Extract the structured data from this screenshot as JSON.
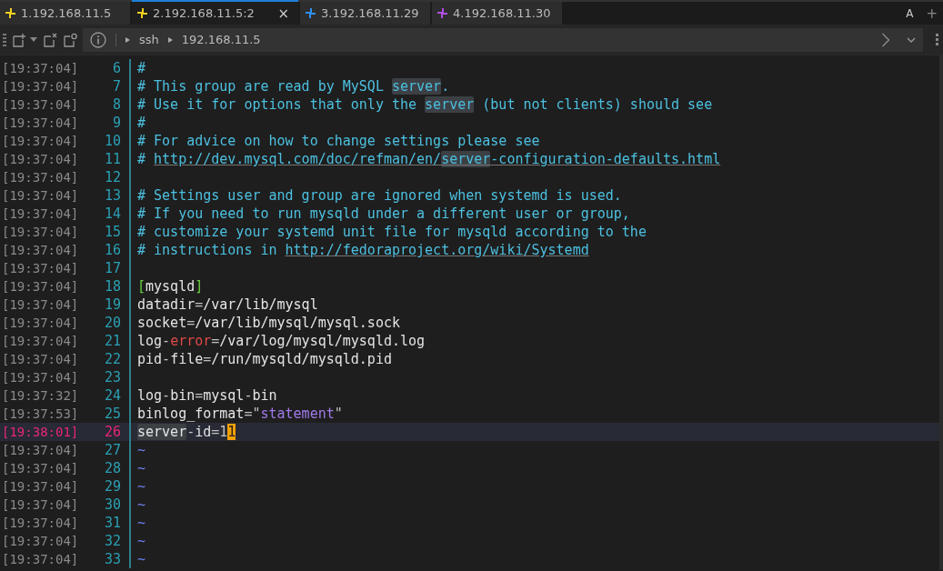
{
  "tabs": [
    {
      "label": "1.192.168.11.5",
      "selected": false,
      "color": "#f0d020"
    },
    {
      "label": "2.192.168.11.5:2",
      "selected": true,
      "close": "×",
      "color": "#f0d020"
    },
    {
      "label": "3.192.168.11.29",
      "selected": false,
      "color": "#2f8ff0"
    },
    {
      "label": "4.192.168.11.30",
      "selected": false,
      "color": "#b050e0"
    }
  ],
  "tab_actions": {
    "font": "A",
    "add": "+"
  },
  "address_bar": {
    "path": [
      "ssh",
      "192.168.11.5"
    ]
  },
  "lines": [
    {
      "time": "[19:37:04]",
      "num": "6",
      "current": false,
      "segments": [
        {
          "kind": "comment",
          "text": "#"
        }
      ]
    },
    {
      "time": "[19:37:04]",
      "num": "7",
      "current": false,
      "segments": [
        {
          "kind": "comment",
          "text": "# This group are read by MySQL "
        },
        {
          "kind": "comment-hl",
          "text": "server"
        },
        {
          "kind": "comment",
          "text": "."
        }
      ]
    },
    {
      "time": "[19:37:04]",
      "num": "8",
      "current": false,
      "segments": [
        {
          "kind": "comment",
          "text": "# Use it for options that only the "
        },
        {
          "kind": "comment-hl",
          "text": "server"
        },
        {
          "kind": "comment",
          "text": " (but not clients) should see"
        }
      ]
    },
    {
      "time": "[19:37:04]",
      "num": "9",
      "current": false,
      "segments": [
        {
          "kind": "comment",
          "text": "#"
        }
      ]
    },
    {
      "time": "[19:37:04]",
      "num": "10",
      "current": false,
      "segments": [
        {
          "kind": "comment",
          "text": "# For advice on how to change settings please see"
        }
      ]
    },
    {
      "time": "[19:37:04]",
      "num": "11",
      "current": false,
      "segments": [
        {
          "kind": "comment",
          "text": "# "
        },
        {
          "kind": "link",
          "text": "http://dev.mysql.com/doc/refman/en/"
        },
        {
          "kind": "link-hl",
          "text": "server"
        },
        {
          "kind": "link",
          "text": "-configuration-defaults.html"
        }
      ]
    },
    {
      "time": "[19:37:04]",
      "num": "12",
      "current": false
    },
    {
      "time": "[19:37:04]",
      "num": "13",
      "current": false,
      "segments": [
        {
          "kind": "comment",
          "text": "# Settings user and group are ignored when systemd is used."
        }
      ]
    },
    {
      "time": "[19:37:04]",
      "num": "14",
      "current": false,
      "segments": [
        {
          "kind": "comment",
          "text": "# If you need to run mysqld under a different user or group,"
        }
      ]
    },
    {
      "time": "[19:37:04]",
      "num": "15",
      "current": false,
      "segments": [
        {
          "kind": "comment",
          "text": "# customize your systemd unit file for mysqld according to the"
        }
      ]
    },
    {
      "time": "[19:37:04]",
      "num": "16",
      "current": false,
      "segments": [
        {
          "kind": "comment",
          "text": "# instructions in "
        },
        {
          "kind": "link",
          "text": "http://fedoraproject.org/wiki/Systemd"
        }
      ]
    },
    {
      "time": "[19:37:04]",
      "num": "17",
      "current": false
    },
    {
      "time": "[19:37:04]",
      "num": "18",
      "current": false,
      "segments": [
        {
          "kind": "bracket",
          "text": "["
        },
        {
          "kind": "text",
          "text": "mysqld"
        },
        {
          "kind": "bracket",
          "text": "]"
        }
      ]
    },
    {
      "time": "[19:37:04]",
      "num": "19",
      "current": false,
      "segments": [
        {
          "kind": "text",
          "text": "datadir"
        },
        {
          "kind": "op",
          "text": "="
        },
        {
          "kind": "text",
          "text": "/var/lib/mysql"
        }
      ]
    },
    {
      "time": "[19:37:04]",
      "num": "20",
      "current": false,
      "segments": [
        {
          "kind": "text",
          "text": "socket"
        },
        {
          "kind": "op",
          "text": "="
        },
        {
          "kind": "text",
          "text": "/var/lib/mysql/mysql.sock"
        }
      ]
    },
    {
      "time": "[19:37:04]",
      "num": "21",
      "current": false,
      "segments": [
        {
          "kind": "text",
          "text": "log"
        },
        {
          "kind": "op",
          "text": "-"
        },
        {
          "kind": "error",
          "text": "error"
        },
        {
          "kind": "op",
          "text": "="
        },
        {
          "kind": "text",
          "text": "/var/log/mysql/mysqld.log"
        }
      ]
    },
    {
      "time": "[19:37:04]",
      "num": "22",
      "current": false,
      "segments": [
        {
          "kind": "text",
          "text": "pid"
        },
        {
          "kind": "op",
          "text": "-"
        },
        {
          "kind": "text",
          "text": "file"
        },
        {
          "kind": "op",
          "text": "="
        },
        {
          "kind": "text",
          "text": "/run/mysqld/mysqld.pid"
        }
      ]
    },
    {
      "time": "[19:37:04]",
      "num": "23",
      "current": false
    },
    {
      "time": "[19:37:32]",
      "num": "24",
      "current": false,
      "segments": [
        {
          "kind": "text",
          "text": "log"
        },
        {
          "kind": "op",
          "text": "-"
        },
        {
          "kind": "text",
          "text": "bin"
        },
        {
          "kind": "op",
          "text": "="
        },
        {
          "kind": "text",
          "text": "mysql"
        },
        {
          "kind": "op",
          "text": "-"
        },
        {
          "kind": "text",
          "text": "bin"
        }
      ]
    },
    {
      "time": "[19:37:53]",
      "num": "25",
      "current": false,
      "segments": [
        {
          "kind": "text",
          "text": "binlog_format"
        },
        {
          "kind": "op",
          "text": "=\""
        },
        {
          "kind": "string",
          "text": "statement"
        },
        {
          "kind": "op",
          "text": "\""
        }
      ]
    },
    {
      "time": "[19:38:01]",
      "num": "26",
      "current": true,
      "segments": [
        {
          "kind": "text-hl",
          "text": "server"
        },
        {
          "kind": "op",
          "text": "-"
        },
        {
          "kind": "text",
          "text": "id"
        },
        {
          "kind": "op",
          "text": "=1"
        },
        {
          "kind": "cursor",
          "text": "1"
        }
      ]
    },
    {
      "time": "[19:37:04]",
      "num": "27",
      "current": false,
      "segments": [
        {
          "kind": "tilde",
          "text": "~"
        }
      ]
    },
    {
      "time": "[19:37:04]",
      "num": "28",
      "current": false,
      "segments": [
        {
          "kind": "tilde",
          "text": "~"
        }
      ]
    },
    {
      "time": "[19:37:04]",
      "num": "29",
      "current": false,
      "segments": [
        {
          "kind": "tilde",
          "text": "~"
        }
      ]
    },
    {
      "time": "[19:37:04]",
      "num": "30",
      "current": false,
      "segments": [
        {
          "kind": "tilde",
          "text": "~"
        }
      ]
    },
    {
      "time": "[19:37:04]",
      "num": "31",
      "current": false,
      "segments": [
        {
          "kind": "tilde",
          "text": "~"
        }
      ]
    },
    {
      "time": "[19:37:04]",
      "num": "32",
      "current": false,
      "segments": [
        {
          "kind": "tilde",
          "text": "~"
        }
      ]
    },
    {
      "time": "[19:37:04]",
      "num": "33",
      "current": false,
      "segments": [
        {
          "kind": "tilde",
          "text": "~"
        }
      ]
    }
  ]
}
